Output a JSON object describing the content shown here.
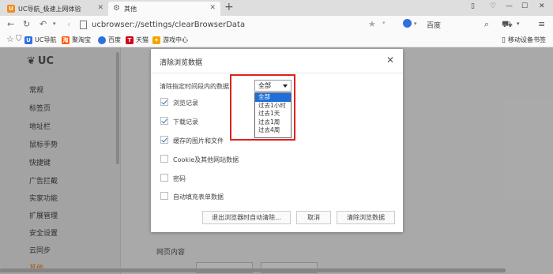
{
  "tabs": [
    {
      "title": "UC导航_极速上网体验",
      "icon": "uc-icon",
      "active": false
    },
    {
      "title": "其他",
      "icon": "gear-icon",
      "active": true
    }
  ],
  "address": {
    "url": "ucbrowser://settings/clearBrowserData"
  },
  "search": {
    "engine": "百度"
  },
  "bookmarks": [
    {
      "label": "UC导航",
      "icon": "uc-icon",
      "color": "#2f6fe0"
    },
    {
      "label": "聚淘宝",
      "icon": "taobao-icon",
      "color": "#ff5a00"
    },
    {
      "label": "百度",
      "icon": "baidu-icon",
      "color": "#2f6fe0"
    },
    {
      "label": "天猫",
      "icon": "tmall-icon",
      "color": "#d4001a"
    },
    {
      "label": "游戏中心",
      "icon": "game-icon",
      "color": "#f2a600"
    }
  ],
  "mobile_bookmarks": "移动设备书签",
  "sidebar": {
    "logo": "UC",
    "items": [
      "常规",
      "标签页",
      "地址栏",
      "鼠标手势",
      "快捷键",
      "广告拦截",
      "实家功能",
      "扩展管理",
      "安全设置",
      "云同步",
      "其他"
    ]
  },
  "main": {
    "section_label": "网页内容"
  },
  "dialog": {
    "title": "清除浏览数据",
    "range_label": "清除指定时间段内的数据",
    "range_selected": "全部",
    "range_options": [
      "全部",
      "过去1小时",
      "过去1天",
      "过去1周",
      "过去4周"
    ],
    "items": [
      {
        "label": "浏览记录",
        "checked": true
      },
      {
        "label": "下载记录",
        "checked": true
      },
      {
        "label": "缓存的图片和文件",
        "checked": true
      },
      {
        "label": "Cookie及其他网站数据",
        "checked": false
      },
      {
        "label": "密码",
        "checked": false
      },
      {
        "label": "自动填充表单数据",
        "checked": false
      }
    ],
    "buttons": {
      "auto_clear": "退出浏览器时自动清除...",
      "cancel": "取消",
      "clear": "清除浏览数据"
    }
  },
  "colors": {
    "accent": "#2f6fe0",
    "highlight_box": "#e02020",
    "uc_orange": "#f08a1c"
  }
}
